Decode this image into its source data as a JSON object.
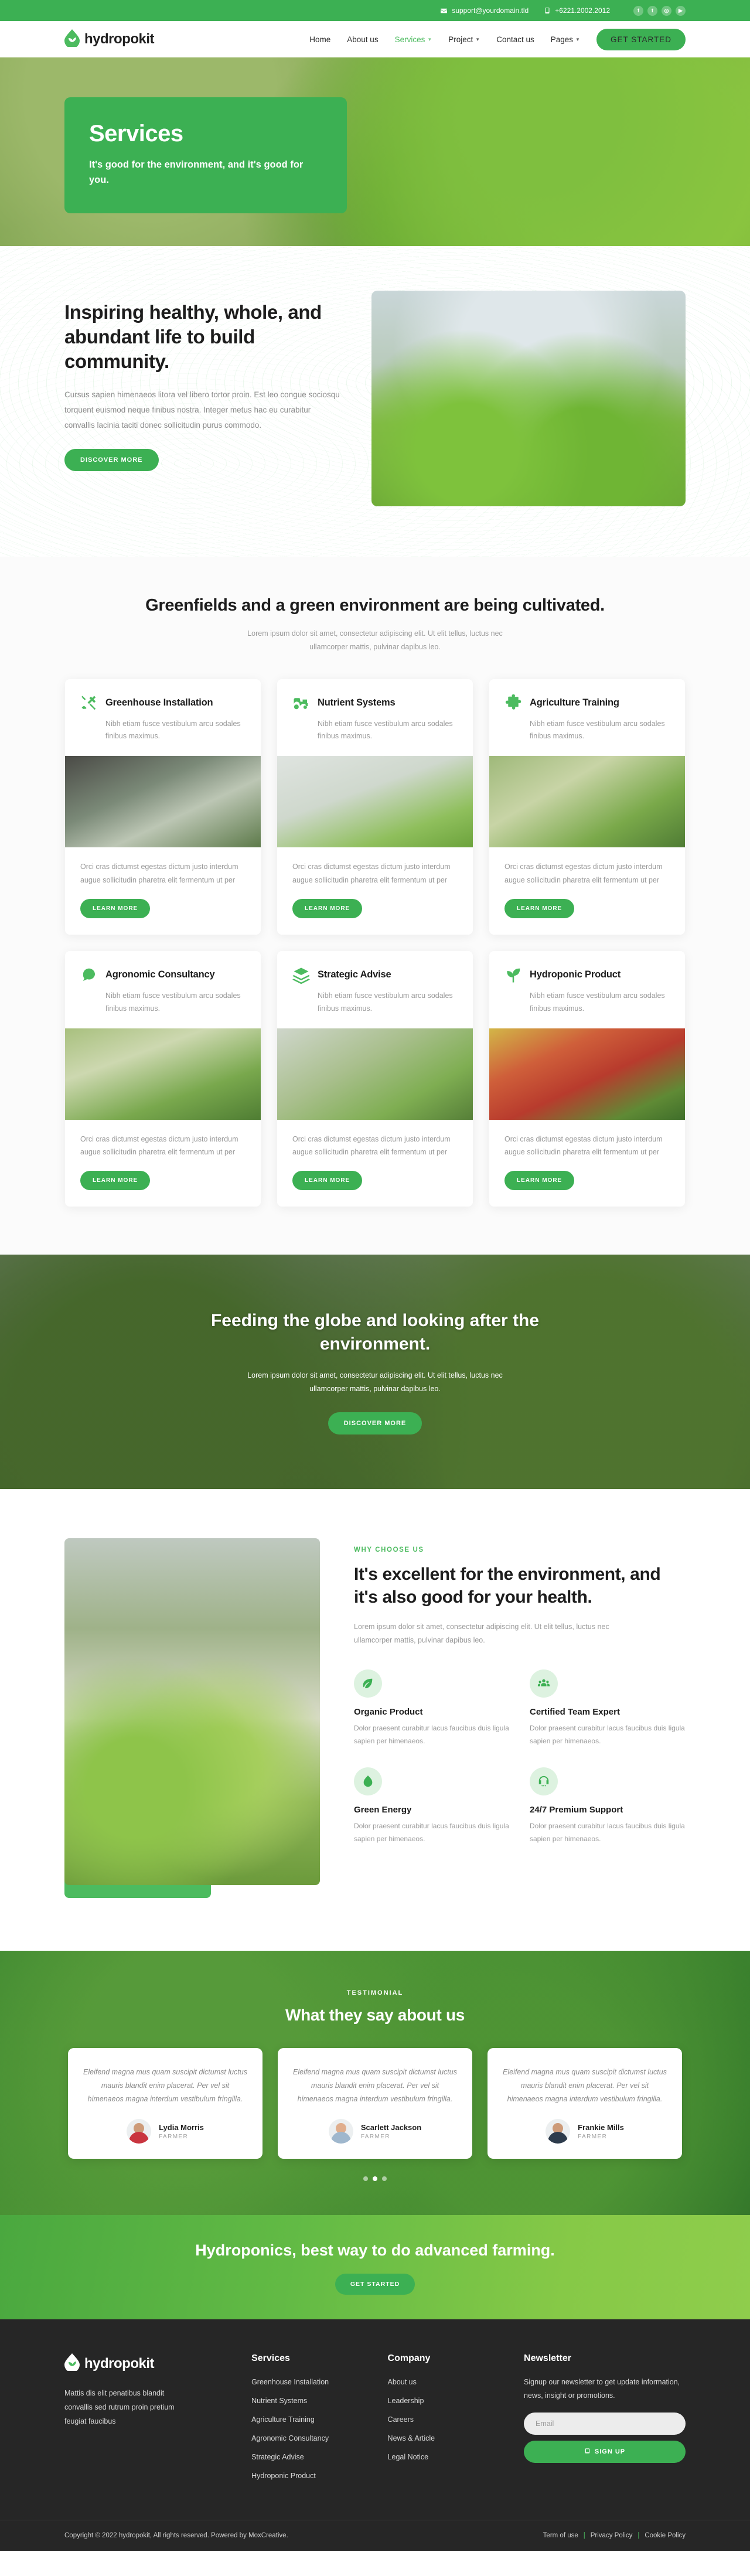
{
  "topbar": {
    "email": "support@yourdomain.tld",
    "phone": "+6221.2002.2012",
    "socials": [
      {
        "name": "facebook-icon",
        "glyph": "f"
      },
      {
        "name": "twitter-icon",
        "glyph": "t"
      },
      {
        "name": "instagram-icon",
        "glyph": "◎"
      },
      {
        "name": "youtube-icon",
        "glyph": "▶"
      }
    ]
  },
  "nav": {
    "brand": "hydropokit",
    "items": [
      {
        "label": "Home",
        "active": false,
        "caret": false
      },
      {
        "label": "About us",
        "active": false,
        "caret": false
      },
      {
        "label": "Services",
        "active": true,
        "caret": true
      },
      {
        "label": "Project",
        "active": false,
        "caret": true
      },
      {
        "label": "Contact us",
        "active": false,
        "caret": false
      },
      {
        "label": "Pages",
        "active": false,
        "caret": true
      }
    ],
    "cta": "GET STARTED"
  },
  "hero": {
    "title": "Services",
    "subtitle": "It's good for the environment, and it's good for you."
  },
  "intro": {
    "heading": "Inspiring healthy, whole, and abundant life to build community.",
    "body": "Cursus sapien himenaeos litora vel libero tortor proin. Est leo congue sociosqu torquent euismod neque finibus nostra. Integer metus hac eu curabitur convallis lacinia taciti donec sollicitudin purus commodo.",
    "button": "DISCOVER MORE"
  },
  "services": {
    "heading": "Greenfields and a green environment are being cultivated.",
    "sub": "Lorem ipsum dolor sit amet, consectetur adipiscing elit. Ut elit tellus, luctus nec ullamcorper mattis, pulvinar dapibus leo.",
    "learn_label": "LEARN MORE",
    "cards": [
      {
        "icon": "tools-icon",
        "title": "Greenhouse Installation",
        "sub": "Nibh etiam fusce vestibulum arcu sodales finibus maximus.",
        "body": "Orci cras dictumst egestas dictum justo interdum augue sollicitudin pharetra elit fermentum ut per"
      },
      {
        "icon": "tractor-icon",
        "title": "Nutrient Systems",
        "sub": "Nibh etiam fusce vestibulum arcu sodales finibus maximus.",
        "body": "Orci cras dictumst egestas dictum justo interdum augue sollicitudin pharetra elit fermentum ut per"
      },
      {
        "icon": "puzzle-icon",
        "title": "Agriculture Training",
        "sub": "Nibh etiam fusce vestibulum arcu sodales finibus maximus.",
        "body": "Orci cras dictumst egestas dictum justo interdum augue sollicitudin pharetra elit fermentum ut per"
      },
      {
        "icon": "chat-bubble-icon",
        "title": "Agronomic Consultancy",
        "sub": "Nibh etiam fusce vestibulum arcu sodales finibus maximus.",
        "body": "Orci cras dictumst egestas dictum justo interdum augue sollicitudin pharetra elit fermentum ut per"
      },
      {
        "icon": "layers-icon",
        "title": "Strategic Advise",
        "sub": "Nibh etiam fusce vestibulum arcu sodales finibus maximus.",
        "body": "Orci cras dictumst egestas dictum justo interdum augue sollicitudin pharetra elit fermentum ut per"
      },
      {
        "icon": "sprout-icon",
        "title": "Hydroponic Product",
        "sub": "Nibh etiam fusce vestibulum arcu sodales finibus maximus.",
        "body": "Orci cras dictumst egestas dictum justo interdum augue sollicitudin pharetra elit fermentum ut per"
      }
    ]
  },
  "feeding": {
    "heading": "Feeding the globe and looking after the environment.",
    "body": "Lorem ipsum dolor sit amet, consectetur adipiscing elit. Ut elit tellus, luctus nec ullamcorper mattis, pulvinar dapibus leo.",
    "button": "DISCOVER MORE"
  },
  "why": {
    "eyebrow": "WHY CHOOSE US",
    "heading": "It's excellent for the environment, and it's also good for your health.",
    "body": "Lorem ipsum dolor sit amet, consectetur adipiscing elit. Ut elit tellus, luctus nec ullamcorper mattis, pulvinar dapibus leo.",
    "features": [
      {
        "icon": "leaf-icon",
        "title": "Organic Product",
        "body": "Dolor praesent curabitur lacus faucibus duis ligula sapien per himenaeos."
      },
      {
        "icon": "team-icon",
        "title": "Certified Team Expert",
        "body": "Dolor praesent curabitur lacus faucibus duis ligula sapien per himenaeos."
      },
      {
        "icon": "energy-leaf-icon",
        "title": "Green Energy",
        "body": "Dolor praesent curabitur lacus faucibus duis ligula sapien per himenaeos."
      },
      {
        "icon": "headset-icon",
        "title": "24/7 Premium Support",
        "body": "Dolor praesent curabitur lacus faucibus duis ligula sapien per himenaeos."
      }
    ]
  },
  "testimonial": {
    "eyebrow": "TESTIMONIAL",
    "heading": "What they say about us",
    "items": [
      {
        "quote": "Eleifend magna mus quam suscipit dictumst luctus mauris blandit enim placerat. Per vel sit himenaeos magna interdum vestibulum fringilla.",
        "name": "Lydia Morris",
        "role": "FARMER"
      },
      {
        "quote": "Eleifend magna mus quam suscipit dictumst luctus mauris blandit enim placerat. Per vel sit himenaeos magna interdum vestibulum fringilla.",
        "name": "Scarlett Jackson",
        "role": "FARMER"
      },
      {
        "quote": "Eleifend magna mus quam suscipit dictumst luctus mauris blandit enim placerat. Per vel sit himenaeos magna interdum vestibulum fringilla.",
        "name": "Frankie Mills",
        "role": "FARMER"
      }
    ],
    "active_dot": 1
  },
  "cta": {
    "heading": "Hydroponics, best way to do advanced farming.",
    "button": "GET STARTED"
  },
  "footer": {
    "brand": "hydropokit",
    "about": "Mattis dis elit penatibus blandit convallis sed rutrum proin pretium feugiat faucibus",
    "services_title": "Services",
    "services": [
      "Greenhouse Installation",
      "Nutrient Systems",
      "Agriculture Training",
      "Agronomic Consultancy",
      "Strategic Advise",
      "Hydroponic Product"
    ],
    "company_title": "Company",
    "company": [
      "About us",
      "Leadership",
      "Careers",
      "News & Article",
      "Legal Notice"
    ],
    "newsletter_title": "Newsletter",
    "newsletter_text": "Signup our newsletter to get update information, news, insight or promotions.",
    "email_placeholder": "Email",
    "signup_label": "SIGN UP",
    "copyright": "Copyright © 2022 hydropokit, All rights reserved. Powered by MoxCreative.",
    "legal": [
      "Term of use",
      "Privacy Policy",
      "Cookie Policy"
    ]
  },
  "colors": {
    "brand_green": "#3cb053",
    "accent_green": "#4cbb5f",
    "dark": "#262626"
  }
}
